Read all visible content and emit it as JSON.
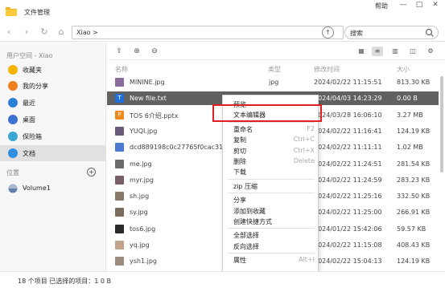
{
  "window": {
    "title": "文件管理",
    "help": "帮助",
    "minimize": "—",
    "restore": "□",
    "close": "✕"
  },
  "toolbar": {
    "path": "Xiao >",
    "search_placeholder": "搜索"
  },
  "sidebar": {
    "user_space_label": "用户空间 - Xiao",
    "items": [
      {
        "label": "收藏夹",
        "icon": "star-icon",
        "color": "#f5b400"
      },
      {
        "label": "我的分享",
        "icon": "share-icon",
        "color": "#f07d1e"
      },
      {
        "label": "最近",
        "icon": "clock-icon",
        "color": "#2d7fd6"
      },
      {
        "label": "桌面",
        "icon": "desktop-icon",
        "color": "#3f6fd1"
      },
      {
        "label": "保险箱",
        "icon": "safe-icon",
        "color": "#3aa6d6"
      },
      {
        "label": "文档",
        "icon": "document-icon",
        "color": "#2f8fe0"
      }
    ],
    "locations_label": "位置",
    "add_location": "+",
    "volume": {
      "label": "Volume1",
      "icon": "disk-icon"
    }
  },
  "columns": {
    "name": "名称",
    "type": "类型",
    "modified": "修改时间",
    "size": "大小"
  },
  "files": [
    {
      "name": "MININE.jpg",
      "type": "jpg",
      "modified": "2024/02/22 11:15:51",
      "size": "813.30 KB",
      "icon": "image-file-icon",
      "color": "#8a6a9a",
      "glyph": ""
    },
    {
      "name": "New file.txt",
      "type": "",
      "modified": "2024/04/03 14:23:29",
      "size": "0.00 B",
      "icon": "text-file-icon",
      "color": "#1e6fd9",
      "glyph": "T"
    },
    {
      "name": "TOS 6介绍.pptx",
      "type": "",
      "modified": "2024/03/28 16:06:10",
      "size": "3.27 MB",
      "icon": "slides-file-icon",
      "color": "#f08a1c",
      "glyph": "P"
    },
    {
      "name": "YUQI.jpg",
      "type": "",
      "modified": "2024/02/22 11:16:41",
      "size": "124.19 KB",
      "icon": "image-file-icon",
      "color": "#6b5b7a",
      "glyph": ""
    },
    {
      "name": "dcd889198c0c27765f0cac3121",
      "type": "",
      "modified": "2024/02/22 11:11:11",
      "size": "1.02 MB",
      "icon": "image-file-icon",
      "color": "#4a7bd0",
      "glyph": ""
    },
    {
      "name": "me.jpg",
      "type": "",
      "modified": "2024/02/22 11:24:51",
      "size": "281.54 KB",
      "icon": "image-file-icon",
      "color": "#6a6a6a",
      "glyph": ""
    },
    {
      "name": "myr.jpg",
      "type": "",
      "modified": "2024/02/22 11:24:59",
      "size": "283.23 KB",
      "icon": "image-file-icon",
      "color": "#7a5f68",
      "glyph": ""
    },
    {
      "name": "sh.jpg",
      "type": "",
      "modified": "2024/02/22 11:25:16",
      "size": "332.50 KB",
      "icon": "image-file-icon",
      "color": "#8a7866",
      "glyph": ""
    },
    {
      "name": "sy.jpg",
      "type": "",
      "modified": "2024/02/22 11:25:00",
      "size": "266.91 KB",
      "icon": "image-file-icon",
      "color": "#7d6b60",
      "glyph": ""
    },
    {
      "name": "tos6.jpg",
      "type": "",
      "modified": "2024/01/22 15:42:06",
      "size": "59.57 KB",
      "icon": "image-file-icon",
      "color": "#2a2a2a",
      "glyph": ""
    },
    {
      "name": "yq.jpg",
      "type": "",
      "modified": "2024/02/22 11:15:08",
      "size": "408.43 KB",
      "icon": "image-file-icon",
      "color": "#c2a48c",
      "glyph": ""
    },
    {
      "name": "ysh1.jpg",
      "type": "",
      "modified": "2024/02/22 15:04:13",
      "size": "124.19 KB",
      "icon": "image-file-icon",
      "color": "#9b8a7e",
      "glyph": ""
    }
  ],
  "context_menu": [
    {
      "label": "预览",
      "key": ""
    },
    {
      "label": "文本编辑器",
      "key": ""
    },
    {
      "sep": true
    },
    {
      "label": "重命名",
      "key": "F2"
    },
    {
      "label": "复制",
      "key": "Ctrl+C"
    },
    {
      "label": "剪切",
      "key": "Ctrl+X"
    },
    {
      "label": "删除",
      "key": "Delete"
    },
    {
      "label": "下载",
      "key": ""
    },
    {
      "sep": true
    },
    {
      "label": "zip 压缩",
      "key": ""
    },
    {
      "sep": true
    },
    {
      "label": "分享",
      "key": ""
    },
    {
      "label": "添加到收藏",
      "key": ""
    },
    {
      "label": "创建快捷方式",
      "key": ""
    },
    {
      "sep": true
    },
    {
      "label": "全部选择",
      "key": ""
    },
    {
      "label": "反向选择",
      "key": ""
    },
    {
      "sep": true
    },
    {
      "label": "属性",
      "key": "Alt+I"
    }
  ],
  "status": "18 个项目    已选择的项目：1    0 B"
}
